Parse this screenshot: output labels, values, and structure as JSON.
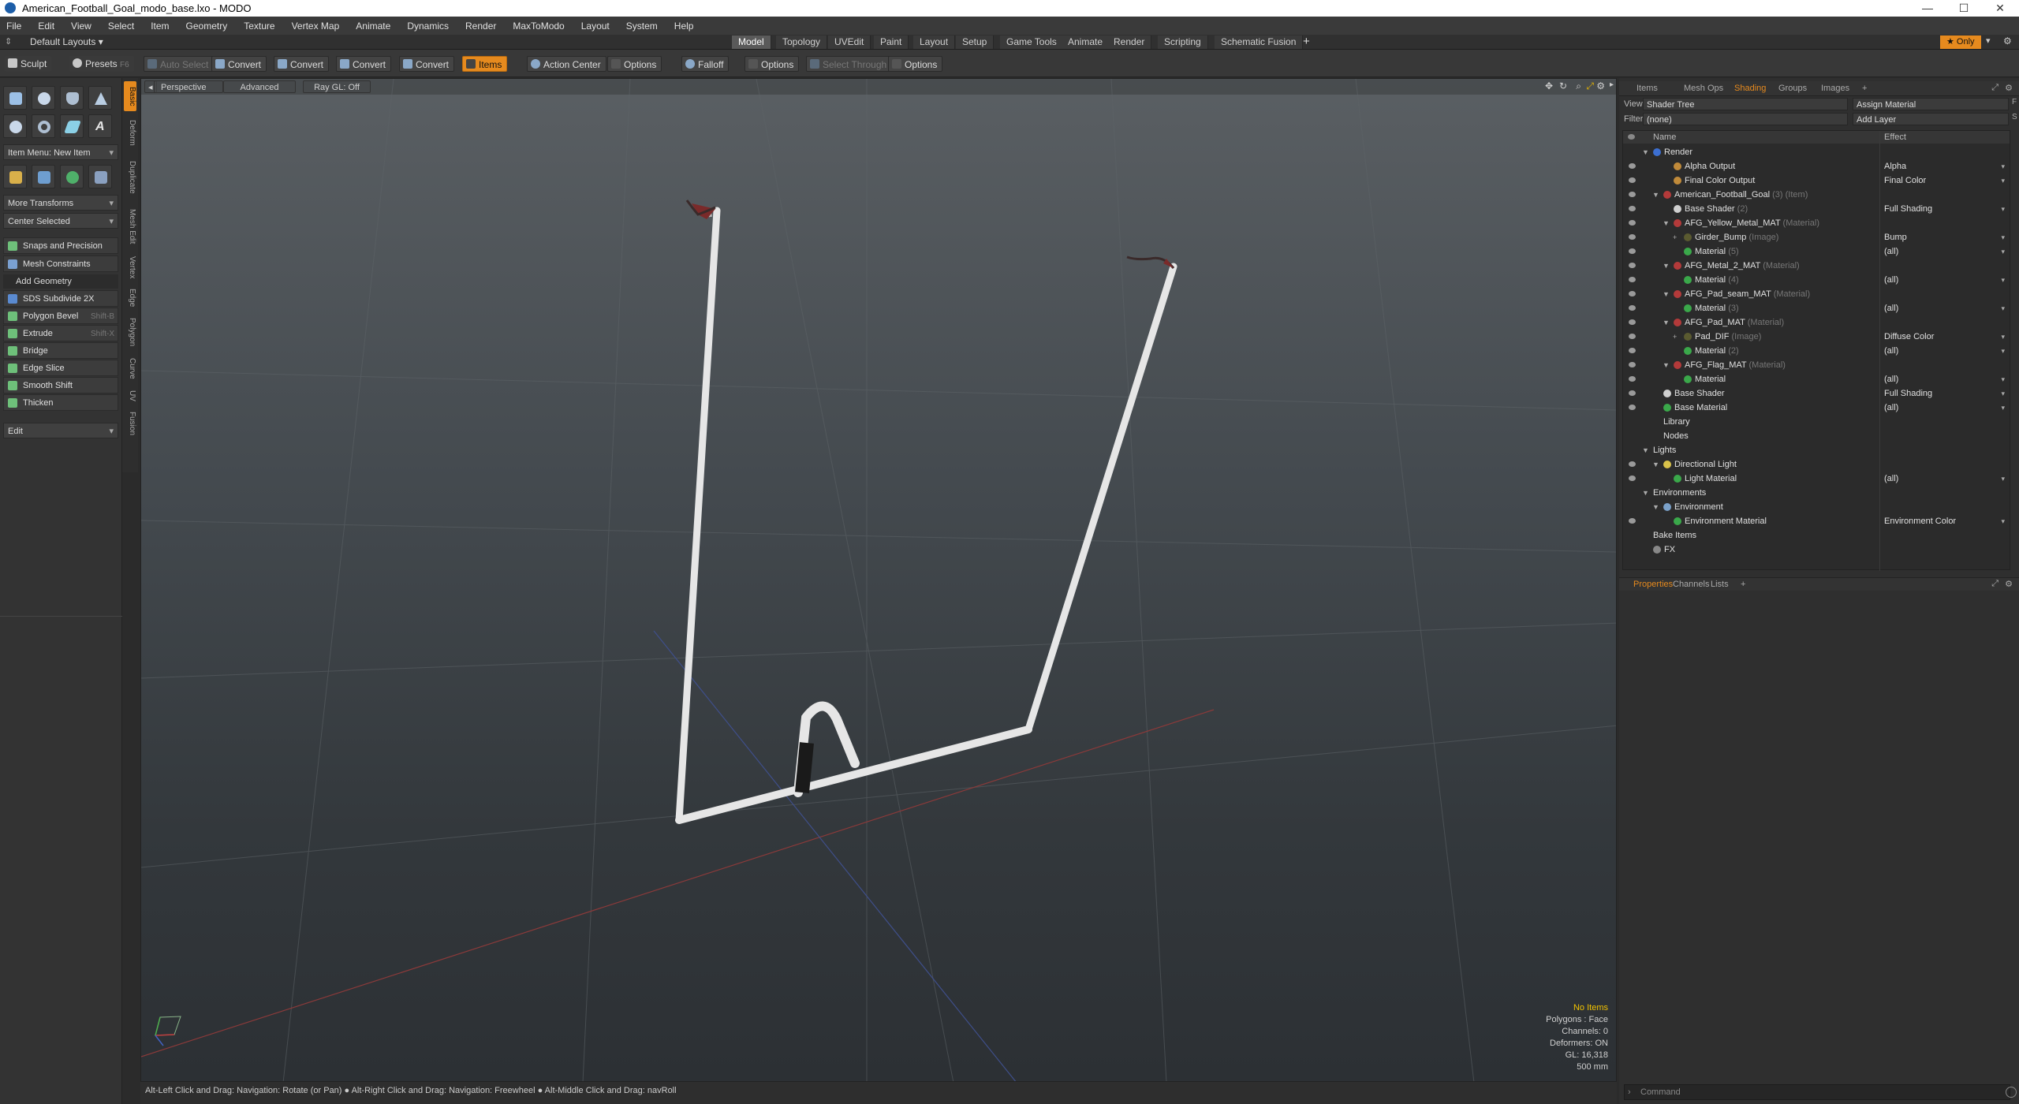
{
  "window": {
    "title": "American_Football_Goal_modo_base.lxo - MODO"
  },
  "menu": [
    "File",
    "Edit",
    "View",
    "Select",
    "Item",
    "Geometry",
    "Texture",
    "Vertex Map",
    "Animate",
    "Dynamics",
    "Render",
    "MaxToModo",
    "Layout",
    "System",
    "Help"
  ],
  "layouts": {
    "preset": "Default Layouts ▾",
    "tabs": [
      "Model",
      "Topology",
      "UVEdit",
      "Paint",
      "Layout",
      "Setup",
      "Game Tools",
      "Animate",
      "Render",
      "Scripting",
      "Schematic Fusion"
    ],
    "active": "Model",
    "plus": "+",
    "only": "★ Only"
  },
  "toolbar": {
    "sculpt": "Sculpt",
    "presets": "Presets",
    "presets_key": "F6",
    "auto_select": "Auto Select",
    "convert": "Convert",
    "items": "Items",
    "action_center": "Action Center",
    "options": "Options",
    "falloff": "Falloff",
    "select_through": "Select Through"
  },
  "left": {
    "vtabs": [
      "Basic",
      "Deform",
      "Duplicate",
      "Mesh Edit",
      "Vertex",
      "Edge",
      "Polygon",
      "Curve",
      "UV",
      "Fusion"
    ],
    "item_menu": "Item Menu: New Item",
    "more_transforms": "More Transforms",
    "center_selected": "Center Selected",
    "snaps": "Snaps and Precision",
    "constraints": "Mesh Constraints",
    "add_geometry": "Add Geometry",
    "tools": [
      {
        "label": "SDS Subdivide 2X",
        "key": ""
      },
      {
        "label": "Polygon Bevel",
        "key": "Shift-B"
      },
      {
        "label": "Extrude",
        "key": "Shift-X"
      },
      {
        "label": "Bridge",
        "key": ""
      },
      {
        "label": "Edge Slice",
        "key": ""
      },
      {
        "label": "Smooth Shift",
        "key": ""
      },
      {
        "label": "Thicken",
        "key": ""
      }
    ],
    "edit": "Edit"
  },
  "viewport": {
    "perspective": "Perspective",
    "advanced": "Advanced",
    "raygl": "Ray GL: Off",
    "stats": {
      "no_items": "No Items",
      "polygons": "Polygons : Face",
      "channels": "Channels: 0",
      "deformers": "Deformers: ON",
      "gl": "GL: 16,318",
      "scale": "500 mm"
    }
  },
  "status": "Alt-Left Click and Drag: Navigation: Rotate (or Pan) ● Alt-Right Click and Drag: Navigation: Freewheel ● Alt-Middle Click and Drag: navRoll",
  "right": {
    "tabs": [
      "Items",
      "Mesh Ops",
      "Shading",
      "Groups",
      "Images",
      "+"
    ],
    "active_tab": "Shading",
    "view_label": "View",
    "view_value": "Shader Tree",
    "assign": "Assign Material",
    "filter_label": "Filter",
    "filter_value": "(none)",
    "add_layer": "Add Layer",
    "col_name": "Name",
    "col_effect": "Effect",
    "rows": [
      {
        "name": "Render",
        "type": "",
        "effect": "",
        "indent": 0,
        "eye": false,
        "arrow": "▼",
        "color": "#3c6fd1"
      },
      {
        "name": "Alpha Output",
        "type": "",
        "effect": "Alpha",
        "indent": 2,
        "eye": true,
        "arrow": "",
        "color": "#c08a3a"
      },
      {
        "name": "Final Color Output",
        "type": "",
        "effect": "Final Color",
        "indent": 2,
        "eye": true,
        "arrow": "",
        "color": "#c08a3a"
      },
      {
        "name": "American_Football_Goal",
        "type": "(3) (Item)",
        "effect": "",
        "indent": 1,
        "eye": true,
        "arrow": "▼",
        "color": "#b33a3a"
      },
      {
        "name": "Base Shader",
        "type": "(2)",
        "effect": "Full Shading",
        "indent": 2,
        "eye": true,
        "arrow": "",
        "color": "#cfcfcf"
      },
      {
        "name": "AFG_Yellow_Metal_MAT",
        "type": "(Material)",
        "effect": "",
        "indent": 2,
        "eye": true,
        "arrow": "▼",
        "color": "#b33a3a"
      },
      {
        "name": "Girder_Bump",
        "type": "(Image)",
        "effect": "Bump",
        "indent": 3,
        "eye": true,
        "arrow": "+",
        "color": "#5a5a30"
      },
      {
        "name": "Material",
        "type": "(5)",
        "effect": "(all)",
        "indent": 3,
        "eye": true,
        "arrow": "",
        "color": "#3aa84a"
      },
      {
        "name": "AFG_Metal_2_MAT",
        "type": "(Material)",
        "effect": "",
        "indent": 2,
        "eye": true,
        "arrow": "▼",
        "color": "#b33a3a"
      },
      {
        "name": "Material",
        "type": "(4)",
        "effect": "(all)",
        "indent": 3,
        "eye": true,
        "arrow": "",
        "color": "#3aa84a"
      },
      {
        "name": "AFG_Pad_seam_MAT",
        "type": "(Material)",
        "effect": "",
        "indent": 2,
        "eye": true,
        "arrow": "▼",
        "color": "#b33a3a"
      },
      {
        "name": "Material",
        "type": "(3)",
        "effect": "(all)",
        "indent": 3,
        "eye": true,
        "arrow": "",
        "color": "#3aa84a"
      },
      {
        "name": "AFG_Pad_MAT",
        "type": "(Material)",
        "effect": "",
        "indent": 2,
        "eye": true,
        "arrow": "▼",
        "color": "#b33a3a"
      },
      {
        "name": "Pad_DIF",
        "type": "(Image)",
        "effect": "Diffuse Color",
        "indent": 3,
        "eye": true,
        "arrow": "+",
        "color": "#5a5a30"
      },
      {
        "name": "Material",
        "type": "(2)",
        "effect": "(all)",
        "indent": 3,
        "eye": true,
        "arrow": "",
        "color": "#3aa84a"
      },
      {
        "name": "AFG_Flag_MAT",
        "type": "(Material)",
        "effect": "",
        "indent": 2,
        "eye": true,
        "arrow": "▼",
        "color": "#b33a3a"
      },
      {
        "name": "Material",
        "type": "",
        "effect": "(all)",
        "indent": 3,
        "eye": true,
        "arrow": "",
        "color": "#3aa84a"
      },
      {
        "name": "Base Shader",
        "type": "",
        "effect": "Full Shading",
        "indent": 1,
        "eye": true,
        "arrow": "",
        "color": "#cfcfcf"
      },
      {
        "name": "Base Material",
        "type": "",
        "effect": "(all)",
        "indent": 1,
        "eye": true,
        "arrow": "",
        "color": "#3aa84a"
      },
      {
        "name": "Library",
        "type": "",
        "effect": "",
        "indent": 1,
        "eye": false,
        "arrow": "",
        "color": ""
      },
      {
        "name": "Nodes",
        "type": "",
        "effect": "",
        "indent": 1,
        "eye": false,
        "arrow": "",
        "color": ""
      },
      {
        "name": "Lights",
        "type": "",
        "effect": "",
        "indent": 0,
        "eye": false,
        "arrow": "▼",
        "color": ""
      },
      {
        "name": "Directional Light",
        "type": "",
        "effect": "",
        "indent": 1,
        "eye": true,
        "arrow": "▼",
        "color": "#d9c24a"
      },
      {
        "name": "Light Material",
        "type": "",
        "effect": "(all)",
        "indent": 2,
        "eye": true,
        "arrow": "",
        "color": "#3aa84a"
      },
      {
        "name": "Environments",
        "type": "",
        "effect": "",
        "indent": 0,
        "eye": false,
        "arrow": "▼",
        "color": ""
      },
      {
        "name": "Environment",
        "type": "",
        "effect": "",
        "indent": 1,
        "eye": false,
        "arrow": "▼",
        "color": "#7aa0c8"
      },
      {
        "name": "Environment Material",
        "type": "",
        "effect": "Environment Color",
        "indent": 2,
        "eye": true,
        "arrow": "",
        "color": "#3aa84a"
      },
      {
        "name": "Bake Items",
        "type": "",
        "effect": "",
        "indent": 0,
        "eye": false,
        "arrow": "",
        "color": ""
      },
      {
        "name": "FX",
        "type": "",
        "effect": "",
        "indent": 0,
        "eye": false,
        "arrow": "",
        "color": "#888888"
      }
    ],
    "prop_tabs": [
      "Properties",
      "Channels",
      "Lists",
      "+"
    ],
    "prop_active": "Properties",
    "command_placeholder": "Command"
  }
}
